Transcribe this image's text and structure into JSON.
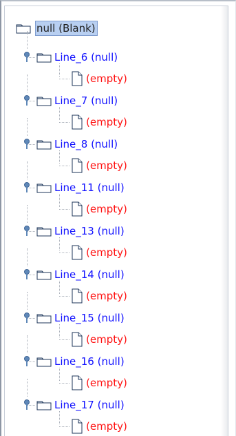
{
  "tree": {
    "root": {
      "label": "null (Blank)"
    },
    "items": [
      {
        "line": "Line_6 (null)",
        "child": "(empty)"
      },
      {
        "line": "Line_7 (null)",
        "child": "(empty)"
      },
      {
        "line": "Line_8 (null)",
        "child": "(empty)"
      },
      {
        "line": "Line_11 (null)",
        "child": "(empty)"
      },
      {
        "line": "Line_13 (null)",
        "child": "(empty)"
      },
      {
        "line": "Line_14 (null)",
        "child": "(empty)"
      },
      {
        "line": "Line_15 (null)",
        "child": "(empty)"
      },
      {
        "line": "Line_16 (null)",
        "child": "(empty)"
      },
      {
        "line": "Line_17 (null)",
        "child": "(empty)"
      }
    ]
  },
  "colors": {
    "line_text": "#1111ff",
    "empty_text": "#ff1111",
    "root_selection": "#b8cff1"
  }
}
